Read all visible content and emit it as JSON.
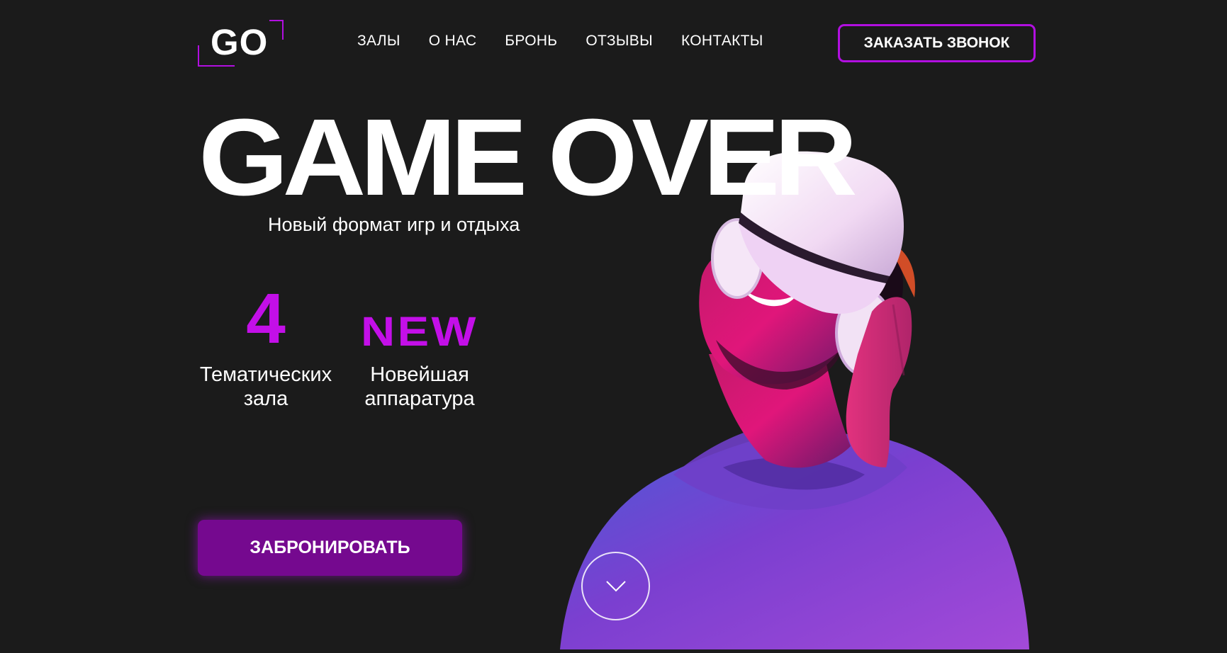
{
  "logo": {
    "text": "GO"
  },
  "nav": {
    "items": [
      {
        "label": "ЗАЛЫ"
      },
      {
        "label": "О НАС"
      },
      {
        "label": "БРОНЬ"
      },
      {
        "label": "ОТЗЫВЫ"
      },
      {
        "label": "КОНТАКТЫ"
      }
    ]
  },
  "header": {
    "call_button_label": "ЗАКАЗАТЬ ЗВОНОК"
  },
  "hero": {
    "title": "GAME OVER",
    "subtitle": "Новый формат игр и отдыха",
    "stats": [
      {
        "value": "4",
        "label": "Тематических\nзала"
      },
      {
        "value": "NEW",
        "label": "Новейшая\nаппаратура"
      }
    ],
    "book_button_label": "ЗАБРОНИРОВАТЬ"
  },
  "icons": {
    "scroll": "chevron-down-icon"
  },
  "colors": {
    "background": "#1b1b1b",
    "accent": "#c30fe8",
    "button_fill": "#75098f",
    "text": "#ffffff"
  }
}
